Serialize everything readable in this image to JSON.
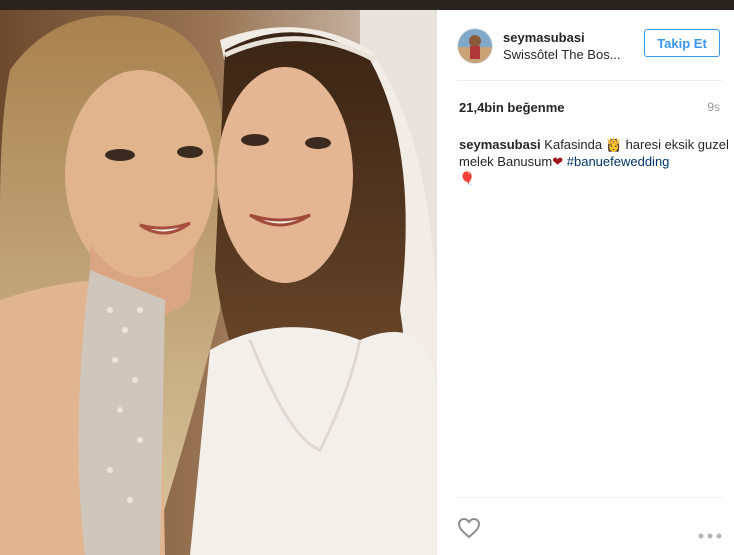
{
  "post": {
    "username": "seymasubasi",
    "location": "Swissôtel The Bos...",
    "follow_label": "Takip Et",
    "likes": "21,4bin beğenme",
    "time": "9s",
    "caption": {
      "username": "seymasubasi",
      "text_part1": "Kafasinda",
      "crown_emoji": "👸",
      "text_part2": "haresi eksik guzel melek Banusum",
      "heart_emoji": "❤",
      "hashtag": "#banuefewedding",
      "balloon_emoji": "🎈"
    }
  },
  "colors": {
    "accent": "#3897f0",
    "hashtag": "#003569",
    "heart": "#a0101a"
  },
  "icons": {
    "like": "heart-outline-icon",
    "more": "more-options-icon"
  }
}
